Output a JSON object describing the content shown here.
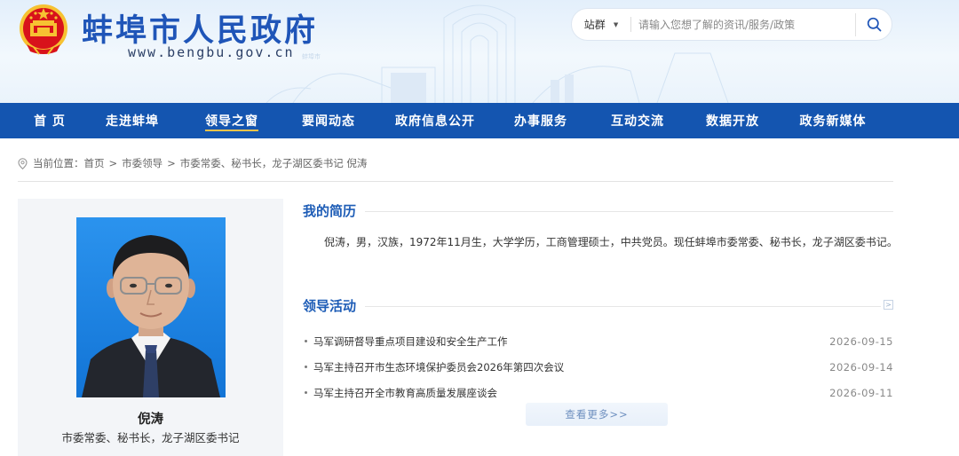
{
  "site": {
    "title": "蚌埠市人民政府",
    "url": "www.bengbu.gov.cn",
    "decor_caption": "蚌埠市"
  },
  "search": {
    "scope": "站群",
    "placeholder": "请输入您想了解的资讯/服务/政策"
  },
  "nav": {
    "items": [
      {
        "label": "首 页"
      },
      {
        "label": "走进蚌埠"
      },
      {
        "label": "领导之窗"
      },
      {
        "label": "要闻动态"
      },
      {
        "label": "政府信息公开"
      },
      {
        "label": "办事服务"
      },
      {
        "label": "互动交流"
      },
      {
        "label": "数据开放"
      },
      {
        "label": "政务新媒体"
      }
    ],
    "active_index": 2
  },
  "breadcrumb": {
    "prefix": "当前位置：",
    "items": [
      "首页",
      "市委领导",
      "市委常委、秘书长，龙子湖区委书记 倪涛"
    ],
    "separator": ">"
  },
  "profile": {
    "name": "倪涛",
    "title": "市委常委、秘书长，龙子湖区委书记"
  },
  "bio_section": {
    "title": "我的简历",
    "text": "倪涛，男，汉族，1972年11月生，大学学历，工商管理硕士，中共党员。现任蚌埠市委常委、秘书长，龙子湖区委书记。"
  },
  "activities": {
    "title": "领导活动",
    "items": [
      {
        "title": "马军调研督导重点项目建设和安全生产工作",
        "date": "2026-09-15"
      },
      {
        "title": "马军主持召开市生态环境保护委员会2026年第四次会议",
        "date": "2026-09-14"
      },
      {
        "title": "马军主持召开全市教育高质量发展座谈会",
        "date": "2026-09-11"
      }
    ],
    "more_label": "查看更多>>"
  },
  "colors": {
    "brand_blue": "#1455b0",
    "title_blue": "#1f55b8",
    "nav_underline": "#f6c24a",
    "emblem_red": "#d8121b",
    "emblem_gold": "#f6c232"
  }
}
